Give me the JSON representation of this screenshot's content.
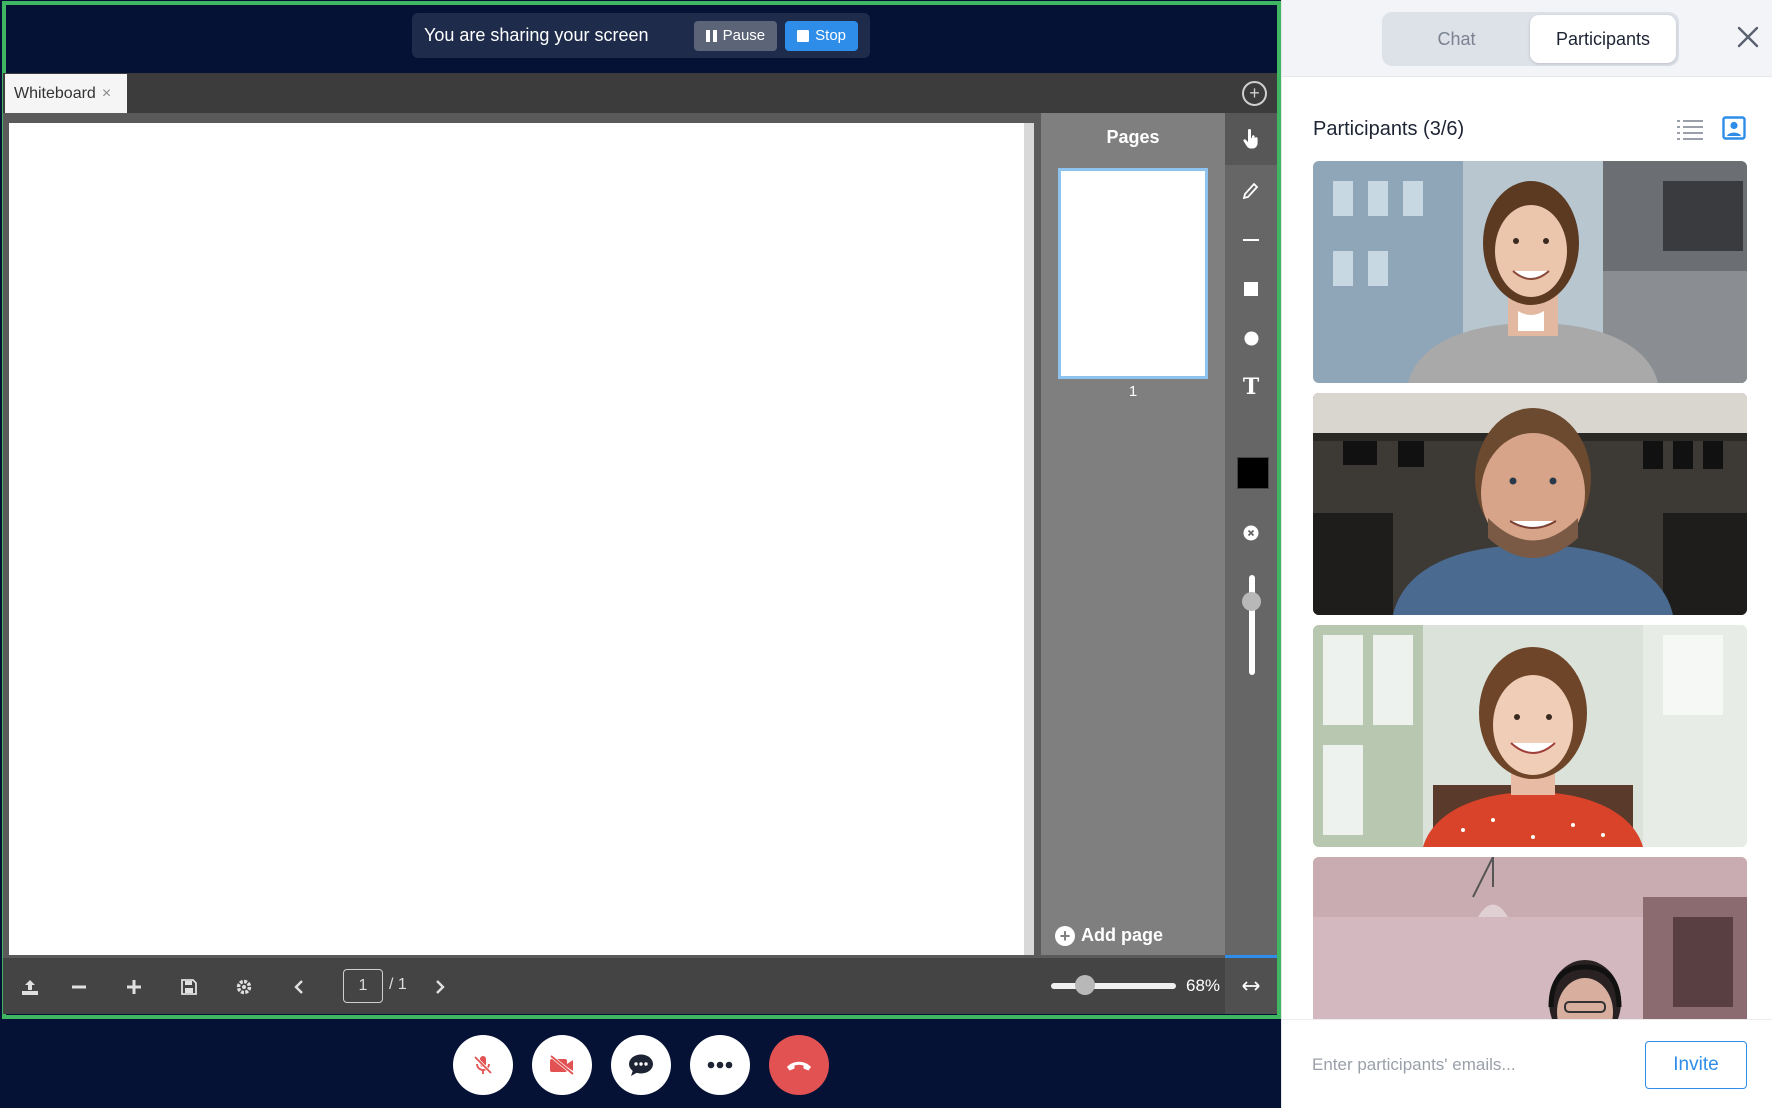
{
  "share_banner": {
    "text": "You are sharing your screen",
    "pause_label": "Pause",
    "stop_label": "Stop"
  },
  "whiteboard": {
    "tab_label": "Whiteboard",
    "tab_close": "×",
    "add_tab": "+",
    "pages_title": "Pages",
    "page_thumbnail_number": "1",
    "add_page_label": "Add page",
    "tools": [
      "pointer-icon",
      "pencil-icon",
      "line-icon",
      "rectangle-icon",
      "circle-icon",
      "text-icon",
      "color-swatch",
      "eraser-icon",
      "size-slider"
    ],
    "text_tool_glyph": "T",
    "active_color": "#000000",
    "footer": {
      "current_page": "1",
      "total_pages": "/ 1",
      "zoom": "68%",
      "zoom_fraction": 0.68
    }
  },
  "call_controls": [
    "mic-off-icon",
    "camera-off-icon",
    "chat-icon",
    "more-icon",
    "end-call-icon"
  ],
  "sidebar": {
    "tabs": [
      {
        "label": "Chat",
        "active": false
      },
      {
        "label": "Participants",
        "active": true
      }
    ],
    "participants_title": "Participants (3/6)",
    "invite_placeholder": "Enter participants' emails...",
    "invite_label": "Invite"
  },
  "colors": {
    "meeting_bg": "#061235",
    "share_border": "#3fb662",
    "accent": "#2e8de8",
    "end_call": "#e25252"
  }
}
